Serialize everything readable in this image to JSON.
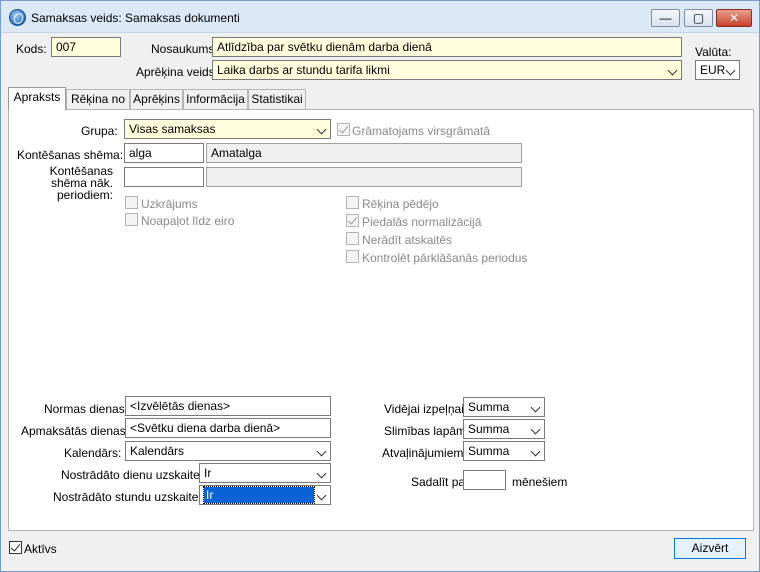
{
  "window": {
    "title": "Samaksas veids: Samaksas dokumenti"
  },
  "header": {
    "kods_label": "Kods:",
    "kods_value": "007",
    "nosaukums_label": "Nosaukums:",
    "nosaukums_value": "Atlīdzība par svētku dienām darba dienā",
    "aprekina_veids_label": "Aprēķina veids:",
    "aprekina_veids_value": "Laika darbs ar stundu tarifa likmi",
    "valuta_label": "Valūta:",
    "valuta_value": "EUR"
  },
  "tabs": [
    {
      "label": "Apraksts",
      "active": true
    },
    {
      "label": "Rēķina no",
      "active": false
    },
    {
      "label": "Aprēķins",
      "active": false
    },
    {
      "label": "Informācija",
      "active": false
    },
    {
      "label": "Statistikai",
      "active": false
    }
  ],
  "apraksts": {
    "grupa_label": "Grupa:",
    "grupa_value": "Visas samaksas",
    "gramatojams_label": "Grāmatojams virsgrāmatā",
    "gramatojams_checked": true,
    "kontesanas_label": "Kontēšanas shēma:",
    "kontesanas_code": "alga",
    "kontesanas_name": "Amatalga",
    "kontesanas_nak_label_1": "Kontēšanas",
    "kontesanas_nak_label_2": "shēma nāk.",
    "kontesanas_nak_label_3": "periodiem:",
    "kontesanas_nak_code": "",
    "kontesanas_nak_name": "",
    "checkboxes_left": [
      {
        "label": "Uzkrājums",
        "checked": false
      },
      {
        "label": "Noapaļot līdz eiro",
        "checked": false
      }
    ],
    "checkboxes_right": [
      {
        "label": "Rēķina pēdējo",
        "checked": false
      },
      {
        "label": "Piedalās normalizācijā",
        "checked": true
      },
      {
        "label": "Nerādīt atskaitēs",
        "checked": false
      },
      {
        "label": "Kontrolēt pārklāšanās periodus",
        "checked": false
      }
    ],
    "normas_label": "Normas dienas:",
    "normas_value": "<Izvēlētās dienas>",
    "apmaksatas_label": "Apmaksātās dienas:",
    "apmaksatas_value": "<Svētku diena darba dienā>",
    "kalendars_label": "Kalendārs:",
    "kalendars_value": "Kalendārs",
    "nostr_dienu_label": "Nostrādāto dienu uzskaite:",
    "nostr_dienu_value": "Ir",
    "nostr_stundu_label": "Nostrādāto stundu uzskaite:",
    "nostr_stundu_value": "Ir",
    "videjai_label": "Vidējai izpeļņai:",
    "videjai_value": "Summa",
    "slimibas_label": "Slimības lapām:",
    "slimibas_value": "Summa",
    "atvalin_label": "Atvaļinājumiem:",
    "atvalin_value": "Summa",
    "sadalit_label": "Sadalīt pa:",
    "sadalit_value": "",
    "menesiem_label": "mēnešiem"
  },
  "footer": {
    "aktivs_label": "Aktīvs",
    "aktivs_checked": true,
    "close_label": "Aizvērt"
  }
}
